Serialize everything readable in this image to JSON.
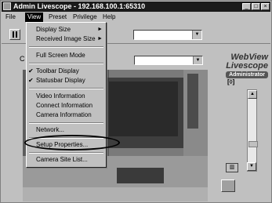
{
  "window": {
    "title": "Admin Livescope - 192.168.100.1:65310"
  },
  "controls": {
    "minimize": "_",
    "maximize": "□",
    "close": "×"
  },
  "menubar": {
    "items": [
      "File",
      "View",
      "Preset",
      "Privilege",
      "Help"
    ]
  },
  "view_menu": {
    "display_size": "Display Size",
    "received_image_size": "Received Image Size",
    "full_screen_mode": "Full Screen Mode",
    "toolbar_display": "Toolbar Display",
    "statusbar_display": "Statusbar Display",
    "video_information": "Video Information",
    "connect_information": "Connect Information",
    "camera_information": "Camera Information",
    "network": "Network...",
    "setup_properties": "Setup Properties...",
    "camera_site_list": "Camera Site List...",
    "checked_items": [
      "toolbar_display",
      "statusbar_display"
    ],
    "submenu_marker": "►",
    "check_mark": "✔"
  },
  "brand": {
    "line1": "WebView",
    "line2": "Livescope",
    "badge": "Administrator"
  },
  "colors": {
    "titlebar": "#1a1a1a",
    "menu_bg": "#c0c0c0",
    "highlight": "#000000"
  }
}
